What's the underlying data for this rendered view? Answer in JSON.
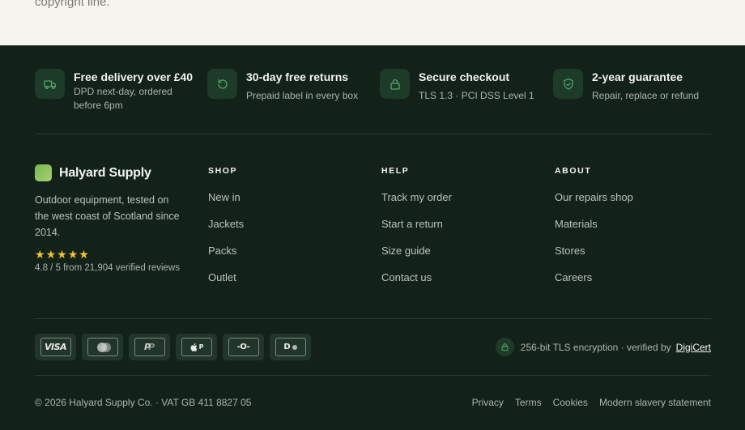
{
  "top": {
    "cut_text": "copyright line."
  },
  "perks": [
    {
      "icon": "truck-icon",
      "title": "Free delivery over £40",
      "sub": "DPD next-day, ordered before 6pm"
    },
    {
      "icon": "returns-icon",
      "title": "30-day free returns",
      "sub": "Prepaid label in every box"
    },
    {
      "icon": "lock-icon",
      "title": "Secure checkout",
      "sub": "TLS 1.3 · PCI DSS Level 1"
    },
    {
      "icon": "shield-check-icon",
      "title": "2-year guarantee",
      "sub": "Repair, replace or refund"
    }
  ],
  "brand": {
    "name": "Halyard Supply",
    "description": "Outdoor equipment, tested on the west coast of Scotland since 2014.",
    "stars": 5,
    "rating_text": "4.8 / 5 from 21,904 verified reviews"
  },
  "columns": [
    {
      "heading": "SHOP",
      "links": [
        "New in",
        "Jackets",
        "Packs",
        "Outlet"
      ]
    },
    {
      "heading": "HELP",
      "links": [
        "Track my order",
        "Start a return",
        "Size guide",
        "Contact us"
      ]
    },
    {
      "heading": "ABOUT",
      "links": [
        "Our repairs shop",
        "Materials",
        "Stores",
        "Careers"
      ]
    }
  ],
  "payments": {
    "visa": "VISA",
    "applepay_letter": "P",
    "ideal": "-O-",
    "diners": "D"
  },
  "secure": {
    "text": "256-bit TLS encryption · verified by",
    "link": "DigiCert"
  },
  "bottom": {
    "copyright": "© 2026 Halyard Supply Co. · VAT GB 411 8827 05",
    "legal": [
      "Privacy",
      "Terms",
      "Cookies",
      "Modern slavery statement"
    ]
  },
  "colors": {
    "footer_bg": "#132219",
    "icon_bg": "#1e3a28",
    "accent_green": "#4fa86a",
    "star": "#f2c232"
  }
}
